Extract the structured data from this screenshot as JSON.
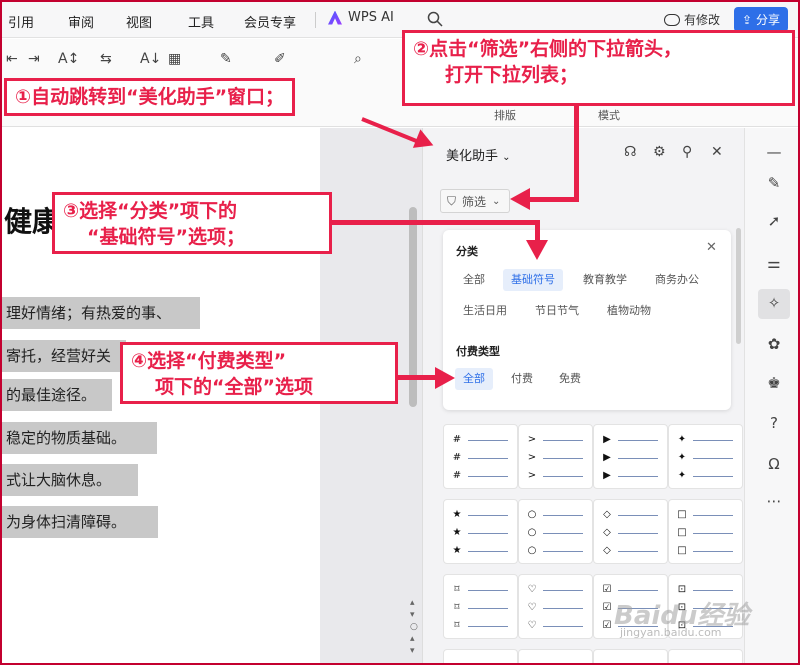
{
  "menu": {
    "items": [
      "引用",
      "审阅",
      "视图",
      "工具",
      "会员专享"
    ],
    "wps_ai": "WPS AI",
    "has_changes": "有修改",
    "share": "分享"
  },
  "toolbar": {
    "labels": [
      "排版",
      "模式"
    ]
  },
  "document": {
    "heading_fragment": "健康",
    "lines": [
      "理好情绪；有热爱的事、",
      "寄托，经营好关",
      "的最佳途径。",
      "稳定的物质基础。",
      "式让大脑休息。",
      "为身体扫清障碍。"
    ]
  },
  "panel": {
    "title": "美化助手",
    "filter_button": "筛选",
    "category_heading": "分类",
    "categories": [
      "全部",
      "基础符号",
      "教育教学",
      "商务办公",
      "生活日用",
      "节日节气",
      "植物动物"
    ],
    "category_selected": "基础符号",
    "pay_heading": "付费类型",
    "pay_types": [
      "全部",
      "付费",
      "免费"
    ],
    "pay_selected": "全部",
    "grid_symbols": [
      [
        "#",
        "#",
        "#"
      ],
      [
        ">",
        ">",
        ">"
      ],
      [
        "▶",
        "▶",
        "▶"
      ],
      [
        "✦",
        "✦",
        "✦"
      ],
      [
        "★",
        "★",
        "★"
      ],
      [
        "○",
        "○",
        "○"
      ],
      [
        "◇",
        "◇",
        "◇"
      ],
      [
        "□",
        "□",
        "□"
      ],
      [
        "⌑",
        "⌑",
        "⌑"
      ],
      [
        "♡",
        "♡",
        "♡"
      ],
      [
        "☑",
        "☑",
        "☑"
      ],
      [
        "⊡",
        "⊡",
        "⊡"
      ]
    ]
  },
  "annotations": {
    "step1": "①自动跳转到“美化助手”窗口；",
    "step2_line1": "②点击“筛选”右侧的下拉箭头，",
    "step2_line2": "打开下拉列表；",
    "step3_line1": "③选择“分类”项下的",
    "step3_line2": "“基础符号”选项；",
    "step4_line1": "④选择“付费类型”",
    "step4_line2": "项下的“全部”选项"
  },
  "colors": {
    "accent": "#2e6fe8",
    "annotation": "#e8204a",
    "selection": "#c8c8c8"
  },
  "watermark": "Baidu经验",
  "watermark_sub": "jingyan.baidu.com"
}
